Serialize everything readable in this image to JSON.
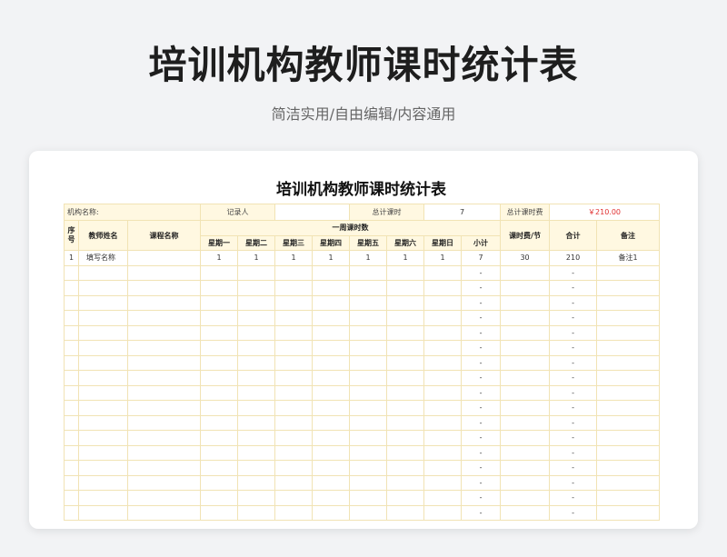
{
  "hero": {
    "title": "培训机构教师课时统计表",
    "subtitle": "简洁实用/自由编辑/内容通用"
  },
  "sheet": {
    "title": "培训机构教师课时统计表",
    "info": {
      "org_label": "机构名称:",
      "recorder_label": "记录人",
      "recorder_value": "",
      "total_hours_label": "总计课时",
      "total_hours_value": "7",
      "total_fee_label": "总计课时费",
      "total_fee_value": "￥210.00"
    },
    "headers": {
      "seq": "序号",
      "teacher": "教师姓名",
      "course": "课程名称",
      "week_group": "一周课时数",
      "days": [
        "星期一",
        "星期二",
        "星期三",
        "星期四",
        "星期五",
        "星期六",
        "星期日"
      ],
      "subtotal": "小计",
      "rate": "课时费/节",
      "total": "合计",
      "remark": "备注"
    },
    "rows": [
      {
        "seq": "1",
        "teacher": "填写名称",
        "course": "",
        "days": [
          "1",
          "1",
          "1",
          "1",
          "1",
          "1",
          "1"
        ],
        "subtotal": "7",
        "rate": "30",
        "total": "210",
        "remark": "备注1"
      },
      {
        "seq": "",
        "teacher": "",
        "course": "",
        "days": [
          "",
          "",
          "",
          "",
          "",
          "",
          ""
        ],
        "subtotal": "-",
        "rate": "",
        "total": "-",
        "remark": ""
      },
      {
        "seq": "",
        "teacher": "",
        "course": "",
        "days": [
          "",
          "",
          "",
          "",
          "",
          "",
          ""
        ],
        "subtotal": "-",
        "rate": "",
        "total": "-",
        "remark": ""
      },
      {
        "seq": "",
        "teacher": "",
        "course": "",
        "days": [
          "",
          "",
          "",
          "",
          "",
          "",
          ""
        ],
        "subtotal": "-",
        "rate": "",
        "total": "-",
        "remark": ""
      },
      {
        "seq": "",
        "teacher": "",
        "course": "",
        "days": [
          "",
          "",
          "",
          "",
          "",
          "",
          ""
        ],
        "subtotal": "-",
        "rate": "",
        "total": "-",
        "remark": ""
      },
      {
        "seq": "",
        "teacher": "",
        "course": "",
        "days": [
          "",
          "",
          "",
          "",
          "",
          "",
          ""
        ],
        "subtotal": "-",
        "rate": "",
        "total": "-",
        "remark": ""
      },
      {
        "seq": "",
        "teacher": "",
        "course": "",
        "days": [
          "",
          "",
          "",
          "",
          "",
          "",
          ""
        ],
        "subtotal": "-",
        "rate": "",
        "total": "-",
        "remark": ""
      },
      {
        "seq": "",
        "teacher": "",
        "course": "",
        "days": [
          "",
          "",
          "",
          "",
          "",
          "",
          ""
        ],
        "subtotal": "-",
        "rate": "",
        "total": "-",
        "remark": ""
      },
      {
        "seq": "",
        "teacher": "",
        "course": "",
        "days": [
          "",
          "",
          "",
          "",
          "",
          "",
          ""
        ],
        "subtotal": "-",
        "rate": "",
        "total": "-",
        "remark": ""
      },
      {
        "seq": "",
        "teacher": "",
        "course": "",
        "days": [
          "",
          "",
          "",
          "",
          "",
          "",
          ""
        ],
        "subtotal": "-",
        "rate": "",
        "total": "-",
        "remark": ""
      },
      {
        "seq": "",
        "teacher": "",
        "course": "",
        "days": [
          "",
          "",
          "",
          "",
          "",
          "",
          ""
        ],
        "subtotal": "-",
        "rate": "",
        "total": "-",
        "remark": ""
      },
      {
        "seq": "",
        "teacher": "",
        "course": "",
        "days": [
          "",
          "",
          "",
          "",
          "",
          "",
          ""
        ],
        "subtotal": "-",
        "rate": "",
        "total": "-",
        "remark": ""
      },
      {
        "seq": "",
        "teacher": "",
        "course": "",
        "days": [
          "",
          "",
          "",
          "",
          "",
          "",
          ""
        ],
        "subtotal": "-",
        "rate": "",
        "total": "-",
        "remark": ""
      },
      {
        "seq": "",
        "teacher": "",
        "course": "",
        "days": [
          "",
          "",
          "",
          "",
          "",
          "",
          ""
        ],
        "subtotal": "-",
        "rate": "",
        "total": "-",
        "remark": ""
      },
      {
        "seq": "",
        "teacher": "",
        "course": "",
        "days": [
          "",
          "",
          "",
          "",
          "",
          "",
          ""
        ],
        "subtotal": "-",
        "rate": "",
        "total": "-",
        "remark": ""
      },
      {
        "seq": "",
        "teacher": "",
        "course": "",
        "days": [
          "",
          "",
          "",
          "",
          "",
          "",
          ""
        ],
        "subtotal": "-",
        "rate": "",
        "total": "-",
        "remark": ""
      },
      {
        "seq": "",
        "teacher": "",
        "course": "",
        "days": [
          "",
          "",
          "",
          "",
          "",
          "",
          ""
        ],
        "subtotal": "-",
        "rate": "",
        "total": "-",
        "remark": ""
      },
      {
        "seq": "",
        "teacher": "",
        "course": "",
        "days": [
          "",
          "",
          "",
          "",
          "",
          "",
          ""
        ],
        "subtotal": "-",
        "rate": "",
        "total": "-",
        "remark": ""
      }
    ]
  },
  "colors": {
    "page_bg": "#f2f3f5",
    "header_fill": "#fff8e1",
    "grid_line": "#f1e3b4",
    "fee_text": "#e03030"
  }
}
